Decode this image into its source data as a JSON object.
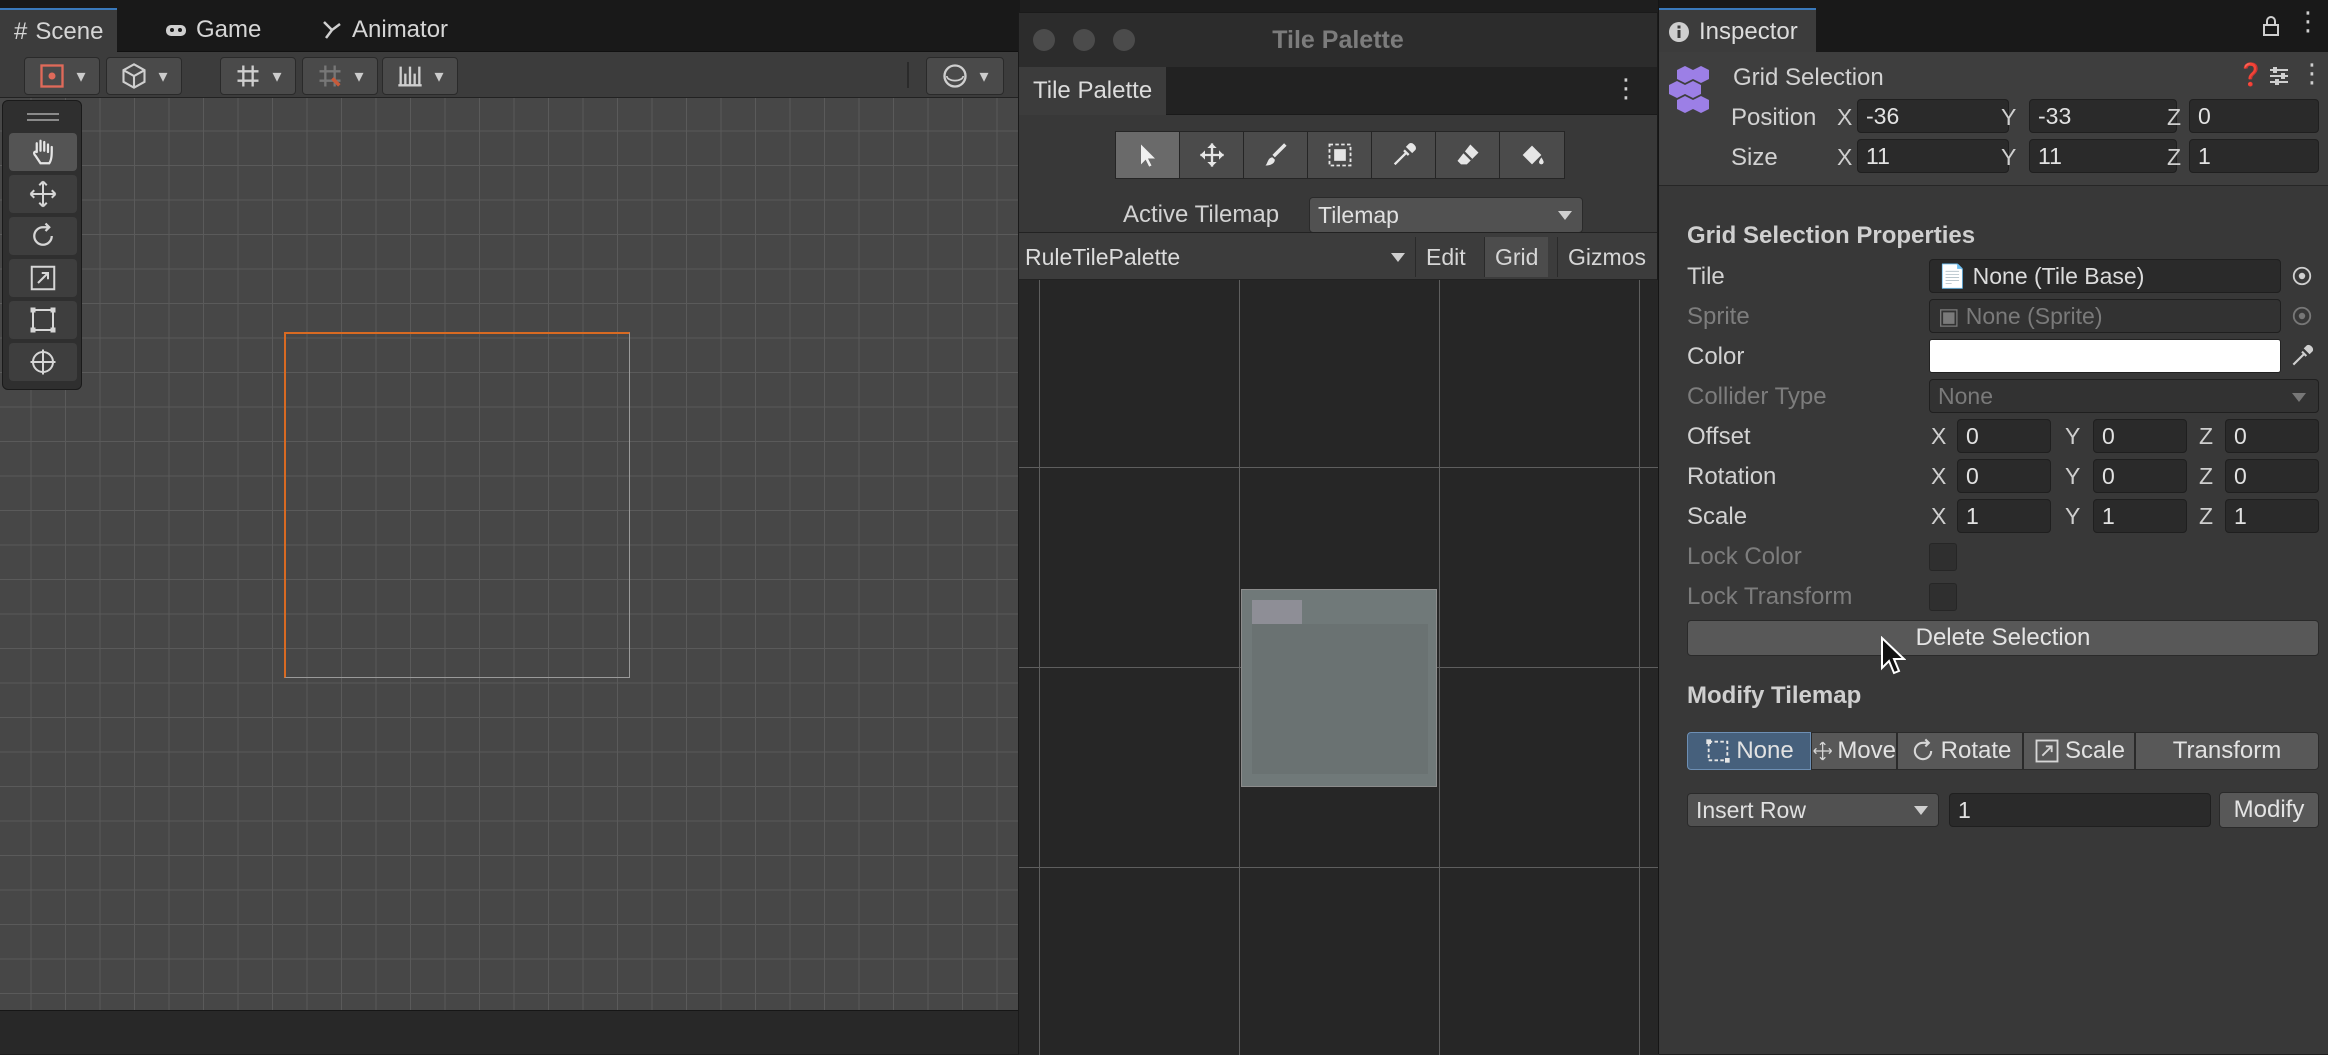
{
  "scene_window": {
    "tabs": [
      {
        "label": "Scene",
        "icon": "hash-icon"
      },
      {
        "label": "Game",
        "icon": "gamepad-icon"
      },
      {
        "label": "Animator",
        "icon": "animator-icon"
      }
    ],
    "tools": [
      "hand-tool-icon",
      "move-tool-icon",
      "rotate-tool-icon",
      "scale-tool-icon",
      "rect-tool-icon",
      "transform-tool-icon"
    ],
    "selection_color": "#d86a22"
  },
  "tile_palette": {
    "window_title": "Tile Palette",
    "tab_label": "Tile Palette",
    "tools": [
      "select-icon",
      "move-icon",
      "paint-brush-icon",
      "box-fill-icon",
      "picker-icon",
      "eraser-icon",
      "fill-bucket-icon"
    ],
    "active_tilemap_label": "Active Tilemap",
    "active_tilemap_value": "Tilemap",
    "palette_name": "RuleTilePalette",
    "edit_label": "Edit",
    "grid_label": "Grid",
    "gizmos_label": "Gizmos"
  },
  "inspector": {
    "tab_label": "Inspector",
    "title": "Grid Selection",
    "position_label": "Position",
    "position": {
      "x": "-36",
      "y": "-33",
      "z": "0"
    },
    "size_label": "Size",
    "size": {
      "x": "11",
      "y": "11",
      "z": "1"
    },
    "axis": {
      "x": "X",
      "y": "Y",
      "z": "Z"
    },
    "props_heading": "Grid Selection Properties",
    "tile_label": "Tile",
    "tile_value": "None (Tile Base)",
    "sprite_label": "Sprite",
    "sprite_value": "None (Sprite)",
    "color_label": "Color",
    "color_value": "#ffffff",
    "collider_label": "Collider Type",
    "collider_value": "None",
    "offset_label": "Offset",
    "offset": {
      "x": "0",
      "y": "0",
      "z": "0"
    },
    "rotation_label": "Rotation",
    "rotation": {
      "x": "0",
      "y": "0",
      "z": "0"
    },
    "scale_label": "Scale",
    "scale": {
      "x": "1",
      "y": "1",
      "z": "1"
    },
    "lock_color_label": "Lock Color",
    "lock_transform_label": "Lock Transform",
    "delete_selection_label": "Delete Selection",
    "modify_heading": "Modify Tilemap",
    "modes": [
      {
        "label": "None",
        "icon": "rect-select-icon",
        "active": true
      },
      {
        "label": "Move",
        "icon": "move-arrows-icon",
        "active": false
      },
      {
        "label": "Rotate",
        "icon": "rotate-icon",
        "active": false
      },
      {
        "label": "Scale",
        "icon": "scale-icon",
        "active": false
      },
      {
        "label": "Transform",
        "icon": "",
        "active": false
      }
    ],
    "insert_mode": "Insert Row",
    "insert_count": "1",
    "modify_label": "Modify"
  }
}
